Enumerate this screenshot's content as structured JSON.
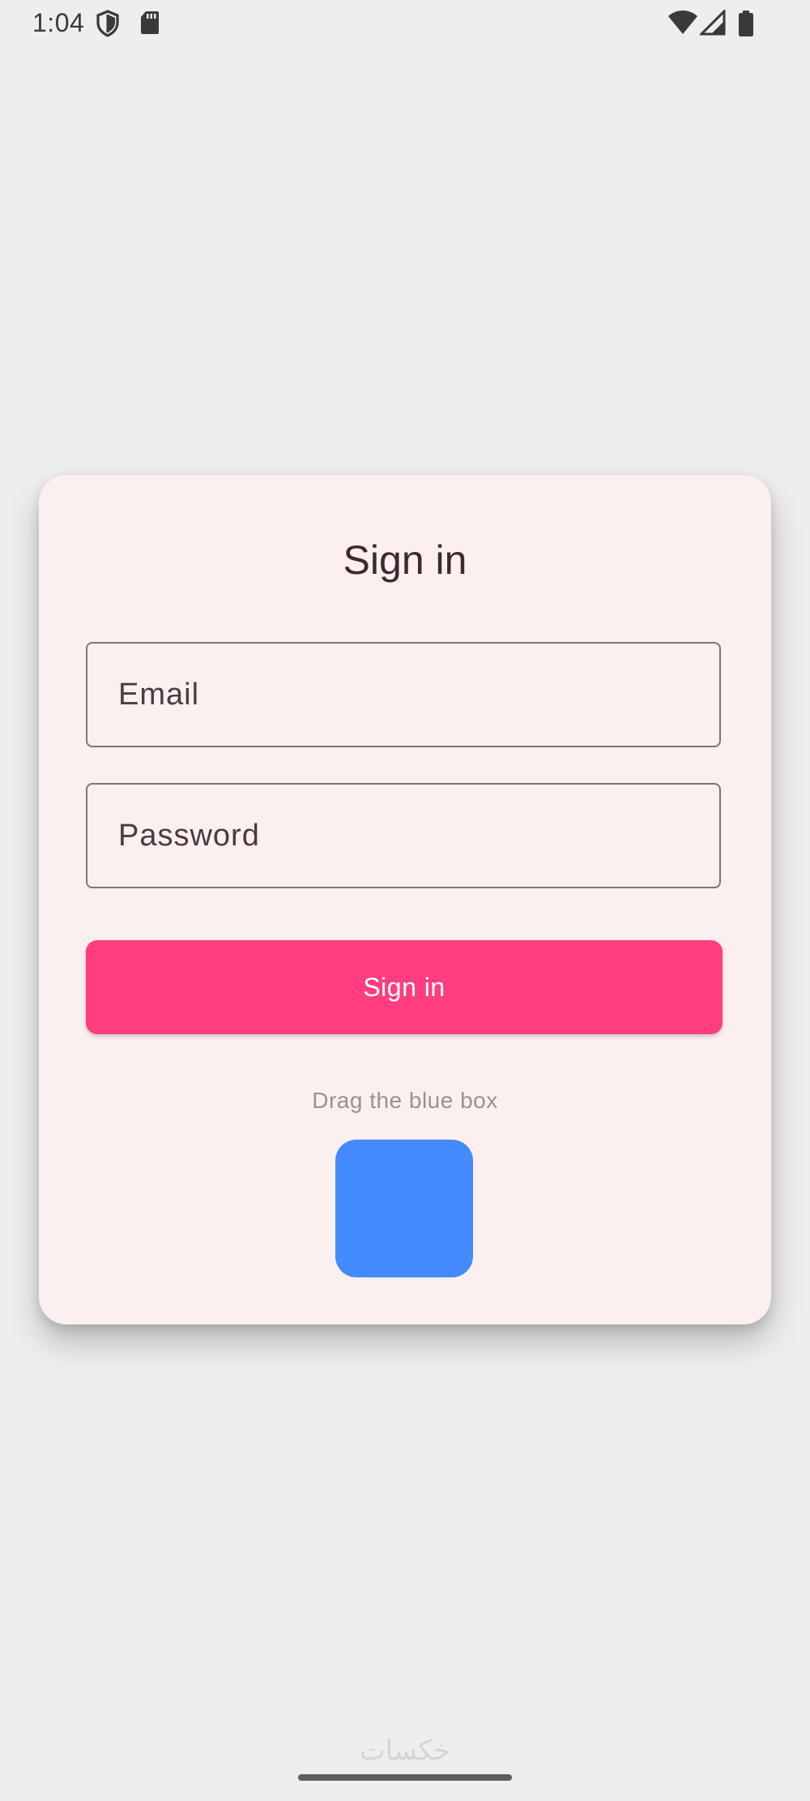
{
  "status_bar": {
    "time": "1:04",
    "icons": [
      "shield-icon",
      "sd-card-icon",
      "wifi-icon",
      "cell-signal-icon",
      "battery-icon"
    ]
  },
  "card": {
    "title": "Sign in",
    "email_field": {
      "label": "Email",
      "value": ""
    },
    "password_field": {
      "label": "Password",
      "value": ""
    },
    "signin_button_label": "Sign in",
    "drag_hint": "Drag the blue box"
  },
  "watermark": "خكسات",
  "colors": {
    "background": "#eeeeee",
    "card": "#fcefef",
    "accent": "#ff3d7f",
    "draggable_box": "#448aff",
    "text": "#3b2b2e"
  }
}
